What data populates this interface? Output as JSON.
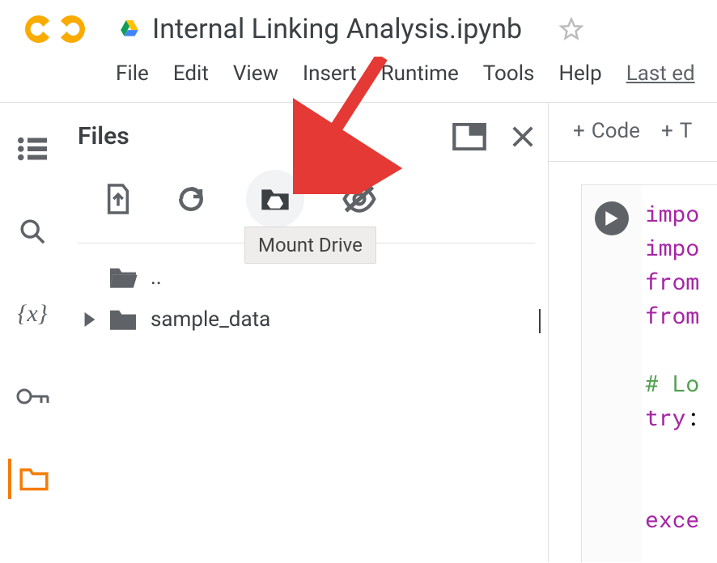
{
  "title": "Internal Linking Analysis.ipynb",
  "menu": {
    "file": "File",
    "edit": "Edit",
    "view": "View",
    "insert": "Insert",
    "runtime": "Runtime",
    "tools": "Tools",
    "help": "Help",
    "last_ed": "Last ed"
  },
  "panel": {
    "title": "Files",
    "tooltip": "Mount Drive",
    "files": {
      "parent": "..",
      "sample": "sample_data"
    }
  },
  "notebook": {
    "add_code": "Code",
    "add_text": "T",
    "plus": "+"
  },
  "code": {
    "l1": "impo",
    "l2": "impo",
    "l3": "from",
    "l4": "from",
    "l5": "",
    "l6_cm": "# Lo",
    "l7_kw": "try",
    "l7_colon": ":",
    "l8": "",
    "l9": "",
    "l10_kw": "exce"
  }
}
